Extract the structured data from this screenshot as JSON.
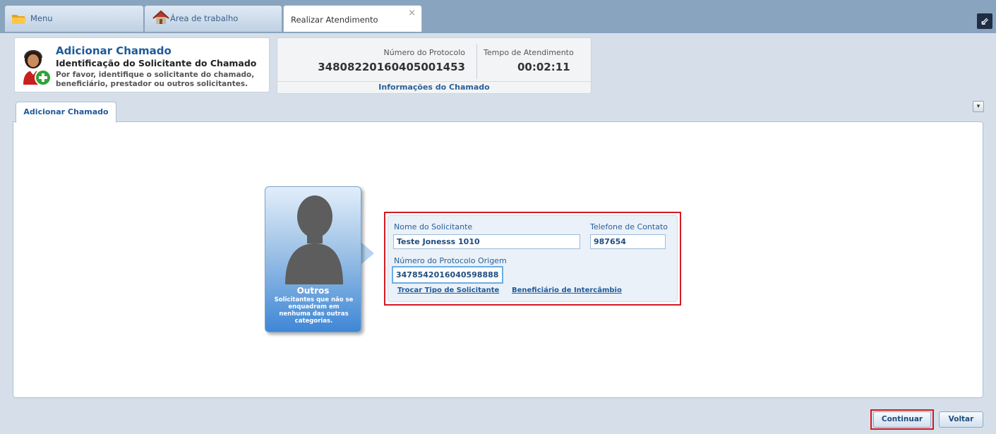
{
  "tabs": {
    "menu": "Menu",
    "workspace": "Área de trabalho",
    "current": "Realizar Atendimento",
    "close": "×",
    "corner": "⇙"
  },
  "header": {
    "title": "Adicionar Chamado",
    "subtitle": "Identificação do Solicitante do Chamado",
    "description": "Por favor, identifique o solicitante do chamado, beneficiário, prestador ou outros solicitantes."
  },
  "info": {
    "protocol_label": "Número do Protocolo",
    "protocol_value": "34808220160405001453",
    "time_label": "Tempo de Atendimento",
    "time_value": "00:02:11",
    "section": "Informações do Chamado"
  },
  "content_tab": "Adicionar Chamado",
  "dropdown": "▾",
  "card": {
    "title": "Outros",
    "description": "Solicitantes que não se enquadram em nenhuma das outras categorias."
  },
  "form": {
    "name_label": "Nome do Solicitante",
    "name_value": "Teste Jonesss 1010",
    "phone_label": "Telefone de Contato",
    "phone_value": "987654",
    "origin_label": "Número do Protocolo Origem",
    "origin_value": "34785420160405988888",
    "link_change": "Trocar Tipo de Solicitante",
    "link_exchange": "Beneficiário de Intercâmbio"
  },
  "buttons": {
    "continue": "Continuar",
    "back": "Voltar"
  },
  "colors": {
    "accent_blue": "#1e5a9a",
    "highlight_red": "#d31a22",
    "topbar": "#89a4bf"
  }
}
